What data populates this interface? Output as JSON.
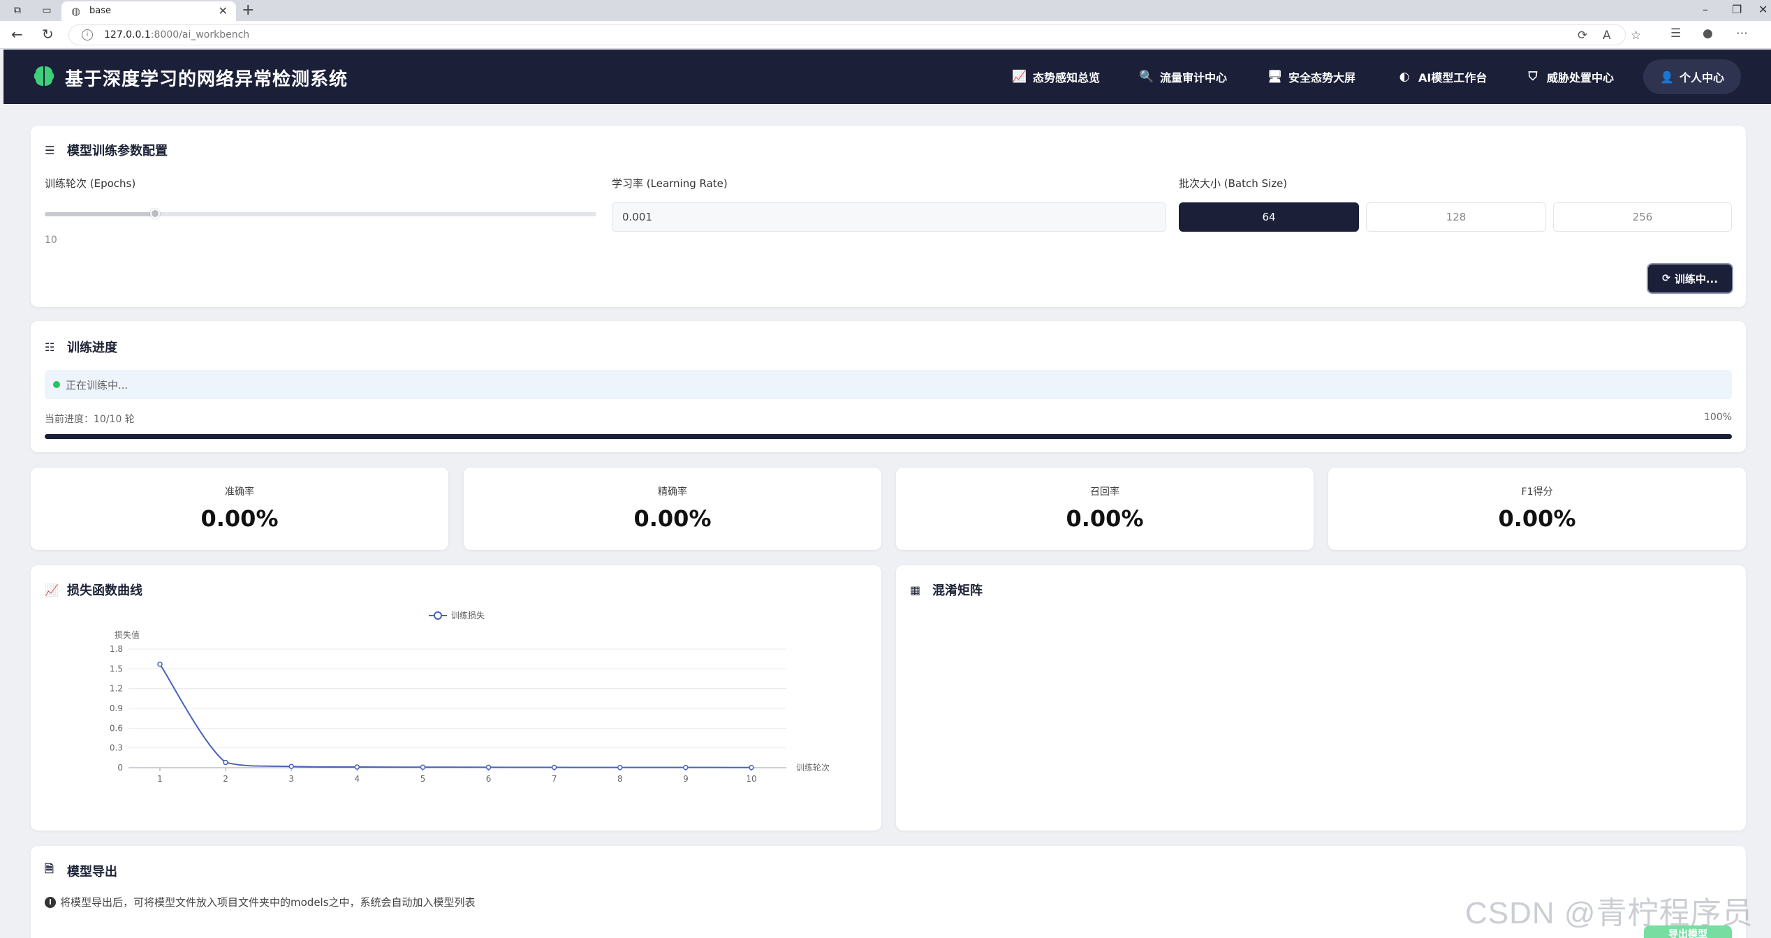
{
  "browser": {
    "tab_title": "base",
    "url_host": "127.0.0.1",
    "url_rest": ":8000/ai_workbench"
  },
  "header": {
    "title": "基于深度学习的网络异常检测系统",
    "nav": [
      {
        "label": "态势感知总览",
        "icon": "chart-line-icon"
      },
      {
        "label": "流量审计中心",
        "icon": "search-icon"
      },
      {
        "label": "安全态势大屏",
        "icon": "monitor-icon"
      },
      {
        "label": "AI模型工作台",
        "icon": "brain-icon"
      },
      {
        "label": "威胁处置中心",
        "icon": "shield-icon"
      }
    ],
    "user_label": "个人中心"
  },
  "config": {
    "title": "模型训练参数配置",
    "epochs_label": "训练轮次 (Epochs)",
    "epochs_value": "10",
    "epochs_fraction": 0.2,
    "lr_label": "学习率 (Learning Rate)",
    "lr_value": "0.001",
    "batch_label": "批次大小 (Batch Size)",
    "batch_options": [
      "64",
      "128",
      "256"
    ],
    "batch_selected": "64",
    "train_button": "训练中..."
  },
  "progress": {
    "title": "训练进度",
    "status": "正在训练中...",
    "current_label": "当前进度：10/10 轮",
    "percent_label": "100%",
    "percent": 100
  },
  "metrics": [
    {
      "label": "准确率",
      "value": "0.00%"
    },
    {
      "label": "精确率",
      "value": "0.00%"
    },
    {
      "label": "召回率",
      "value": "0.00%"
    },
    {
      "label": "F1得分",
      "value": "0.00%"
    }
  ],
  "loss_panel": {
    "title": "损失函数曲线"
  },
  "confusion_panel": {
    "title": "混淆矩阵"
  },
  "export": {
    "title": "模型导出",
    "info": "将模型导出后，可将模型文件放入项目文件夹中的models之中，系统会自动加入模型列表",
    "button": "导出模型"
  },
  "watermark": "CSDN @青柠程序员",
  "chart_data": {
    "type": "line",
    "legend": [
      "训练损失"
    ],
    "ylabel": "损失值",
    "xlabel": "训练轮次",
    "x": [
      1,
      2,
      3,
      4,
      5,
      6,
      7,
      8,
      9,
      10
    ],
    "yticks": [
      "0",
      "0.3",
      "0.6",
      "0.9",
      "1.2",
      "1.5",
      "1.8"
    ],
    "ylim": [
      0,
      1.8
    ],
    "series": [
      {
        "name": "训练损失",
        "values": [
          1.57,
          0.08,
          0.02,
          0.01,
          0.008,
          0.006,
          0.005,
          0.004,
          0.004,
          0.003
        ]
      }
    ],
    "color": "#4a62b8",
    "grid": true
  }
}
